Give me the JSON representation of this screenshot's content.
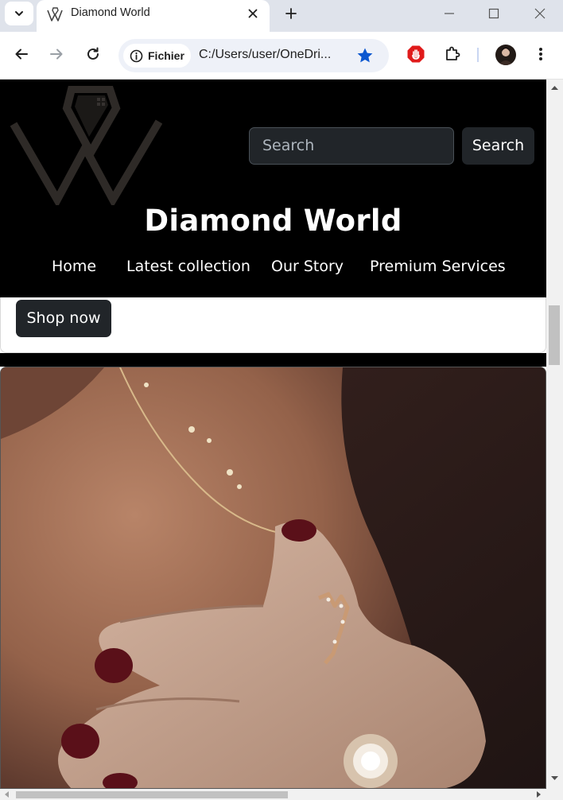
{
  "browser": {
    "tab_title": "Diamond World",
    "site_chip_label": "Fichier",
    "url": "C:/Users/user/OneDri...",
    "icons": {
      "tab_search": "chevron-down-icon",
      "favicon": "diamond-world-logo-icon",
      "tab_close": "close-icon",
      "new_tab": "plus-icon",
      "minimize": "minimize-icon",
      "maximize": "maximize-icon",
      "close_window": "close-icon",
      "back": "back-arrow-icon",
      "forward": "forward-arrow-icon",
      "reload": "reload-icon",
      "info": "info-icon",
      "bookmark": "star-icon",
      "adblock": "stop-hand-icon",
      "extensions": "puzzle-icon",
      "profile": "avatar",
      "menu": "more-vertical-icon"
    }
  },
  "page": {
    "search": {
      "placeholder": "Search",
      "button_label": "Search"
    },
    "brand": "Diamond World",
    "nav": [
      "Home",
      "Latest collection",
      "Our Story",
      "Premium Services"
    ],
    "cta_label": "Shop now",
    "colors": {
      "header_bg": "#000000",
      "button_bg": "#212529",
      "text_light": "#ffffff"
    }
  }
}
